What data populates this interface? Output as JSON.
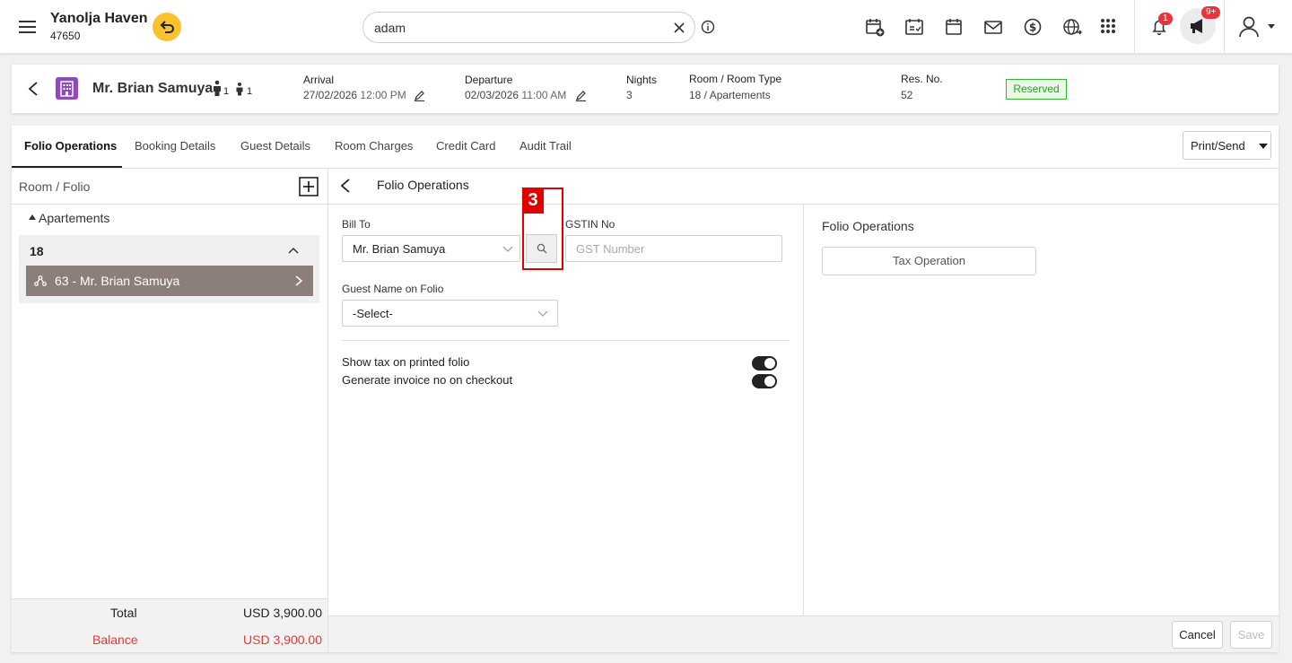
{
  "topbar": {
    "hotel_name": "Yanolja Haven",
    "hotel_id": "47650",
    "search_value": "adam",
    "notification_count": "1",
    "announcement_count": "9+"
  },
  "guest": {
    "name": "Mr. Brian Samuya",
    "adults": "1",
    "children": "1",
    "arrival_label": "Arrival",
    "arrival_date": "27/02/2026",
    "arrival_time": "12:00 PM",
    "departure_label": "Departure",
    "departure_date": "02/03/2026",
    "departure_time": "11:00 AM",
    "nights_label": "Nights",
    "nights": "3",
    "room_label": "Room / Room Type",
    "room": "18 / Apartements",
    "res_label": "Res. No.",
    "res_no": "52",
    "status": "Reserved"
  },
  "tabs": [
    "Folio Operations",
    "Booking Details",
    "Guest Details",
    "Room Charges",
    "Credit Card",
    "Audit Trail"
  ],
  "print_send": "Print/Send",
  "left_panel": {
    "title": "Room / Folio",
    "group": "Apartements",
    "room": "18",
    "folio": "63 - Mr. Brian Samuya",
    "total_label": "Total",
    "total_value": "USD 3,900.00",
    "balance_label": "Balance",
    "balance_value": "USD 3,900.00"
  },
  "folio_form": {
    "title": "Folio Operations",
    "bill_to_label": "Bill To",
    "bill_to_value": "Mr. Brian Samuya",
    "gstin_label": "GSTIN No",
    "gstin_placeholder": "GST Number",
    "guest_name_label": "Guest Name on Folio",
    "guest_name_value": "-Select-",
    "show_tax_label": "Show tax on printed folio",
    "generate_invoice_label": "Generate invoice no on checkout",
    "step_marker": "3"
  },
  "right_panel": {
    "title": "Folio Operations",
    "tax_operation": "Tax Operation"
  },
  "footer": {
    "cancel": "Cancel",
    "save": "Save"
  },
  "colors": {
    "accent_yellow": "#f9c22e",
    "folio_selected": "#8c7f7a",
    "status_green": "#2eb82e",
    "balance_red": "#e8353b",
    "marker_red": "#e00000"
  }
}
